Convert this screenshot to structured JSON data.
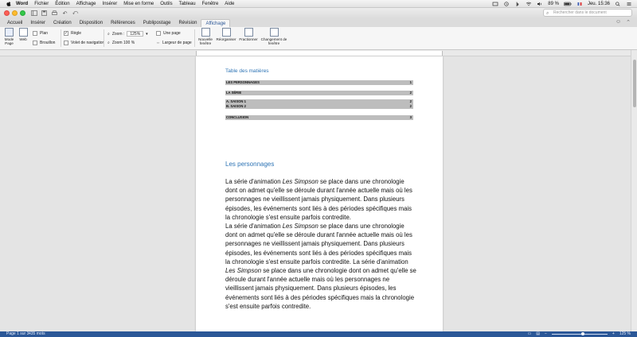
{
  "menubar": {
    "app": "Word",
    "items": [
      "Fichier",
      "Édition",
      "Affichage",
      "Insérer",
      "Mise en forme",
      "Outils",
      "Tableau",
      "Fenêtre",
      "Aide"
    ],
    "battery": "89 %",
    "clock": "Jeu. 15:36"
  },
  "titlebar": {
    "search_placeholder": "Rechercher dans le document"
  },
  "ribbon_tabs": [
    "Accueil",
    "Insérer",
    "Création",
    "Disposition",
    "Références",
    "Publipostage",
    "Révision",
    "Affichage"
  ],
  "active_tab": "Affichage",
  "ribbon": {
    "mode_page": "Mode Page",
    "web": "Web",
    "plan": "Plan",
    "brouillon": "Brouillon",
    "regle": "Règle",
    "volet_navigation": "Volet de navigation",
    "zoom_label": "Zoom :",
    "zoom_value": "125%",
    "zoom_100": "Zoom 100 %",
    "une_page": "Une page",
    "largeur_page": "Largeur de page",
    "nouvelle_fenetre": "Nouvelle fenêtre",
    "reorganiser": "Réorganiser",
    "fractionner": "Fractionner",
    "changement_fenetre": "Changement de fenêtre"
  },
  "document": {
    "toc_title": "Table des matières",
    "toc": [
      {
        "label": "LES PERSONNAGES",
        "page": "1"
      },
      {
        "label": "LA SÉRIE",
        "page": "2"
      },
      {
        "label": "A. SAISON 1",
        "page": "2"
      },
      {
        "label": "B. SAISON 2",
        "page": "2"
      },
      {
        "label": "CONCLUSION",
        "page": "3"
      }
    ],
    "heading": "Les personnages",
    "para1_a": "La série d'animation ",
    "para1_b": "Les Simpson",
    "para1_c": " se place dans une chronologie dont on admet qu'elle se déroule durant l'année actuelle mais où les personnages ne vieillissent jamais physiquement. Dans plusieurs épisodes, les événements sont liés à des périodes spécifiques mais la chronologie s'est ensuite parfois contredite.",
    "para2_a": "La série d'animation ",
    "para2_b": "Les Simpson",
    "para2_c": " se place dans une chronologie dont on admet qu'elle se déroule durant l'année actuelle mais où les personnages ne vieillissent jamais physiquement. Dans plusieurs épisodes, les événements sont liés à des périodes spécifiques mais la chronologie s'est ensuite parfois contredite. La série d'animation ",
    "para2_d": "Les Simpson",
    "para2_e": " se place dans une chronologie dont on admet qu'elle se déroule durant l'année actuelle mais où les personnages ne vieillissent jamais physiquement. Dans plusieurs épisodes, les événements sont liés à des périodes spécifiques mais la chronologie s'est ensuite parfois contredite."
  },
  "status": {
    "page": "Page 1 sur 3",
    "words": "435 mots",
    "zoom": "125 %"
  }
}
